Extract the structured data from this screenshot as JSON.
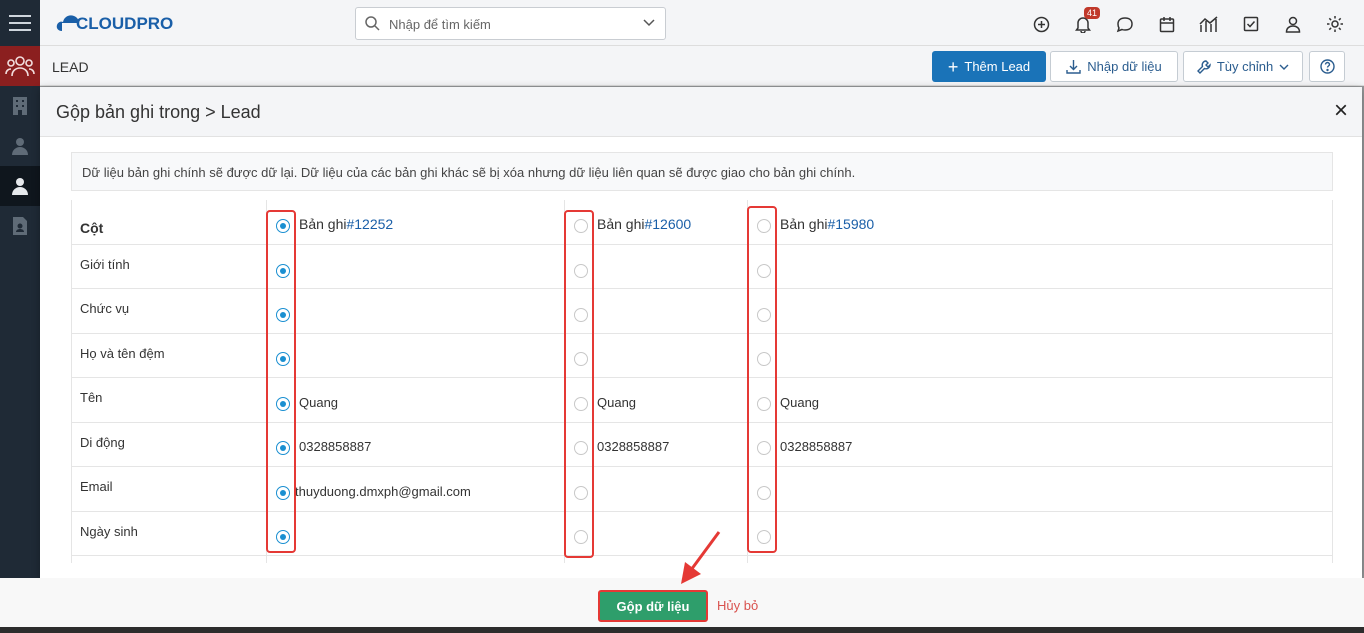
{
  "app": {
    "logo_text": "CLOUDPRO"
  },
  "search": {
    "placeholder": "Nhập để tìm kiếm"
  },
  "notifications": {
    "count": "41"
  },
  "module": {
    "title": "LEAD"
  },
  "actions": {
    "add_lead": "Thêm Lead",
    "import": "Nhập dữ liệu",
    "customize": "Tùy chỉnh"
  },
  "modal": {
    "title": "Gộp bản ghi trong > Lead",
    "notice": "Dữ liệu bản ghi chính sẽ được dữ lại. Dữ liệu của các bản ghi khác sẽ bị xóa nhưng dữ liệu liên quan sẽ được giao cho bản ghi chính.",
    "column_header": "Cột",
    "record_prefix": "Bản ghi",
    "records": [
      {
        "id": "#12252",
        "selected": true
      },
      {
        "id": "#12600",
        "selected": false
      },
      {
        "id": "#15980",
        "selected": false
      }
    ],
    "fields": [
      {
        "label": "Giới tính",
        "values": [
          "",
          "",
          ""
        ]
      },
      {
        "label": "Chức vụ",
        "values": [
          "",
          "",
          ""
        ]
      },
      {
        "label": "Họ và tên đệm",
        "values": [
          "",
          "",
          ""
        ]
      },
      {
        "label": "Tên",
        "values": [
          "Quang",
          "Quang",
          "Quang"
        ]
      },
      {
        "label": "Di động",
        "values": [
          "0328858887",
          "0328858887",
          "0328858887"
        ]
      },
      {
        "label": "Email",
        "values": [
          "thuyduong.dmxph@gmail.com",
          "",
          ""
        ]
      },
      {
        "label": "Ngày sinh",
        "values": [
          "",
          "",
          ""
        ]
      }
    ]
  },
  "footer": {
    "merge": "Gộp dữ liệu",
    "cancel": "Hủy bỏ"
  },
  "colors": {
    "primary": "#1a73b8",
    "success": "#2e9e6b",
    "highlight": "#e53935",
    "link": "#1a5fa8"
  }
}
